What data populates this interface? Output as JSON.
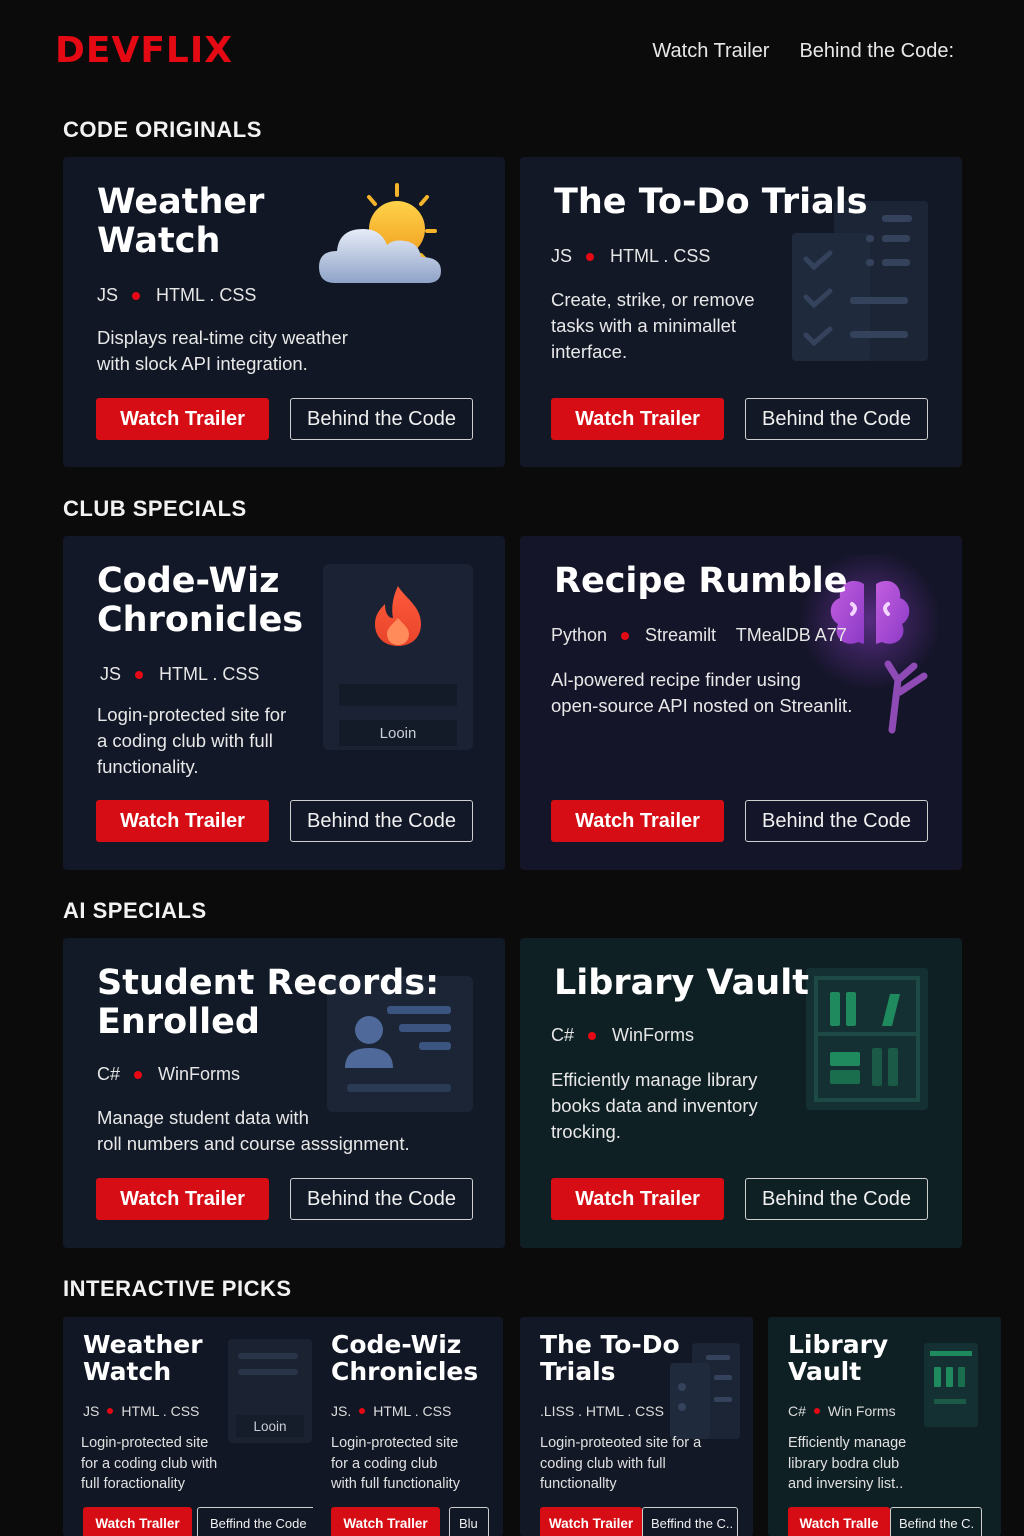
{
  "brand": {
    "logo": "DEVFLIX",
    "accent": "#e50914"
  },
  "nav": {
    "items": [
      "Watch Trailer",
      "Behind the Code:"
    ]
  },
  "sections": [
    {
      "title": "CODE ORIGINALS",
      "cards": [
        {
          "title_lines": [
            "Weather",
            "Watch"
          ],
          "tags": [
            "JS",
            "HTML . CSS"
          ],
          "desc_lines": [
            "Displays real-time city weather",
            "with slock API integration."
          ],
          "primary": "Watch Trailer",
          "secondary": "Behind the Code",
          "icon": "weather-icon"
        },
        {
          "title_lines": [
            "The To-Do Trials"
          ],
          "tags": [
            "JS",
            "HTML . CSS"
          ],
          "desc_lines": [
            "Create, strike, or remove",
            "tasks with a minimallet",
            "interface."
          ],
          "primary": "Watch Trailer",
          "secondary": "Behind the Code",
          "icon": "checklist-icon"
        }
      ]
    },
    {
      "title": "CLUB SPECIALS",
      "cards": [
        {
          "title_lines": [
            "Code-Wiz",
            "Chronicles"
          ],
          "tags": [
            "JS",
            "HTML . CSS"
          ],
          "desc_lines": [
            "Login-protected site for",
            "a coding club with full",
            "functionality."
          ],
          "primary": "Watch Trailer",
          "secondary": "Behind the Code",
          "icon": "login-fire-icon",
          "art_text": "Looin"
        },
        {
          "title_lines": [
            "Recipe Rumble"
          ],
          "tags": [
            "Python",
            "Streamilt    TMealDB A77"
          ],
          "desc_lines": [
            "Al-powered recipe finder using",
            "open-source API nosted on Streanlit."
          ],
          "primary": "Watch Trailer",
          "secondary": "Behind the Code",
          "icon": "brain-icon"
        }
      ]
    },
    {
      "title": "AI SPECIALS",
      "cards": [
        {
          "title_lines": [
            "Student Records:",
            "Enrolled"
          ],
          "tags": [
            "C#",
            "WinForms"
          ],
          "desc_lines": [
            "Manage student data with",
            "roll numbers and course asssignment."
          ],
          "primary": "Watch Trailer",
          "secondary": "Behind the Code",
          "icon": "id-card-icon"
        },
        {
          "title_lines": [
            "Library Vault"
          ],
          "tags": [
            "C#",
            "WinForms"
          ],
          "desc_lines": [
            "Efficiently manage library",
            "books data and inventory",
            "trocking."
          ],
          "primary": "Watch Trailer",
          "secondary": "Behind the Code",
          "icon": "bookshelf-icon"
        }
      ]
    }
  ],
  "interactive": {
    "title": "INTERACTIVE PICKS",
    "cards": [
      {
        "title_lines": [
          "Weather",
          "Watch"
        ],
        "tags": [
          "JS",
          "HTML . CSS"
        ],
        "desc_lines": [
          "Login-protected site",
          "for a coding club with",
          "full foractionality"
        ],
        "primary": "Watch Traller",
        "secondary": "Beffind the Code",
        "art_text": "Looin"
      },
      {
        "title_lines": [
          "Code-Wiz",
          "Chronicles"
        ],
        "tags": [
          "JS.",
          "HTML . CSS"
        ],
        "desc_lines": [
          "Login-protected site",
          "for a coding club",
          "with full functionality"
        ],
        "primary": "Watch Traller",
        "secondary": "Blu"
      },
      {
        "title_lines": [
          "The To-Do",
          "Trials"
        ],
        "tags": [
          ".LISS . HTML . CSS"
        ],
        "desc_lines": [
          "Login-proteoted site for a",
          "coding club with full",
          "functionallty"
        ],
        "primary": "Watch Trailer",
        "secondary": "Beffind the C.."
      },
      {
        "title_lines": [
          "Library",
          "Vault"
        ],
        "tags": [
          "C#",
          "Win Forms"
        ],
        "desc_lines": [
          "Efficiently manage",
          "library bodra club",
          "and inversiny list.."
        ],
        "primary": "Watch Tralle",
        "secondary": "Befind the C."
      }
    ]
  }
}
